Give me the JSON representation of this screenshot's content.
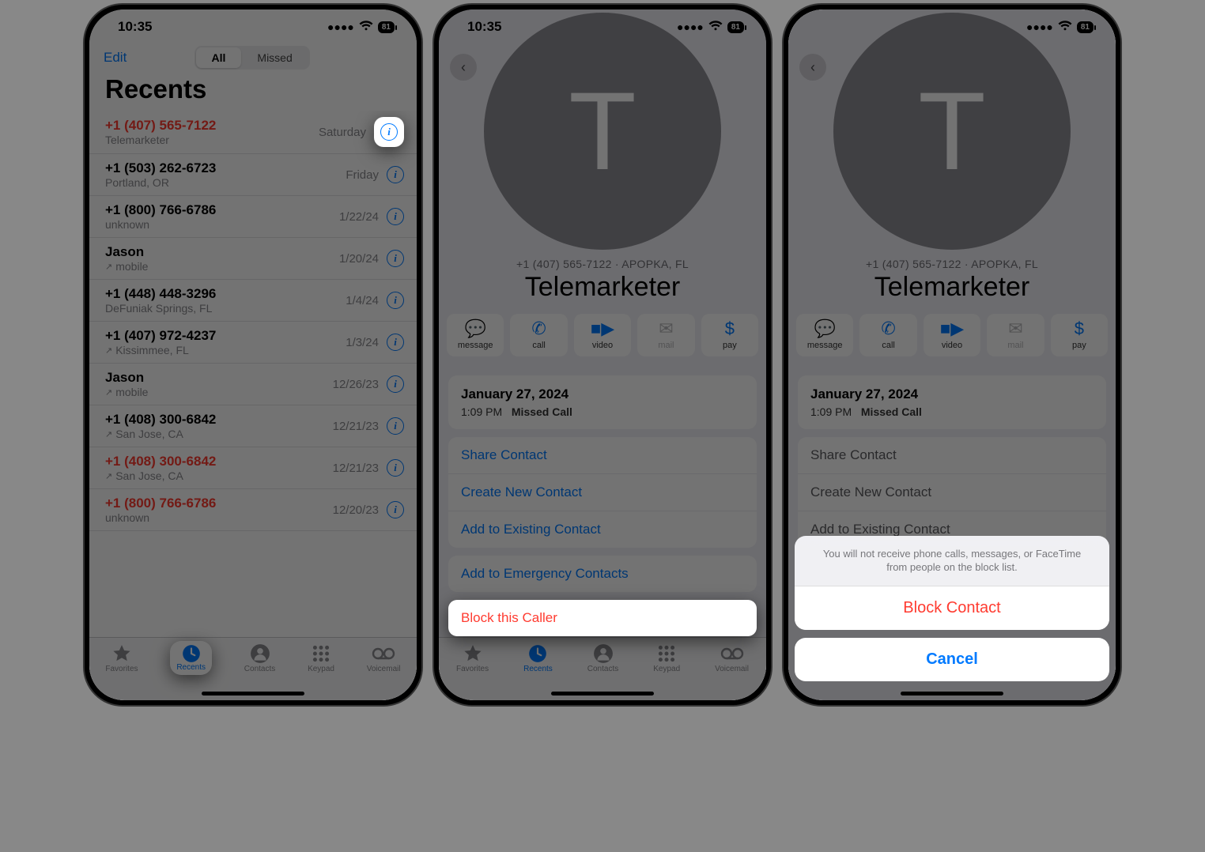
{
  "status": {
    "time": "10:35",
    "battery": "81"
  },
  "screen1": {
    "edit": "Edit",
    "segments": {
      "all": "All",
      "missed": "Missed"
    },
    "title": "Recents",
    "calls": [
      {
        "num": "+1 (407) 565-7122",
        "sub": "Telemarketer",
        "when": "Saturday",
        "missed": true,
        "outgoing": false,
        "highlight": true
      },
      {
        "num": "+1 (503) 262-6723",
        "sub": "Portland, OR",
        "when": "Friday",
        "missed": false,
        "outgoing": false
      },
      {
        "num": "+1 (800) 766-6786",
        "sub": "unknown",
        "when": "1/22/24",
        "missed": false,
        "outgoing": false
      },
      {
        "num": "Jason",
        "sub": "mobile",
        "when": "1/20/24",
        "missed": false,
        "outgoing": true
      },
      {
        "num": "+1 (448) 448-3296",
        "sub": "DeFuniak Springs, FL",
        "when": "1/4/24",
        "missed": false,
        "outgoing": false
      },
      {
        "num": "+1 (407) 972-4237",
        "sub": "Kissimmee, FL",
        "when": "1/3/24",
        "missed": false,
        "outgoing": true
      },
      {
        "num": "Jason",
        "sub": "mobile",
        "when": "12/26/23",
        "missed": false,
        "outgoing": true
      },
      {
        "num": "+1 (408) 300-6842",
        "sub": "San Jose, CA",
        "when": "12/21/23",
        "missed": false,
        "outgoing": true
      },
      {
        "num": "+1 (408) 300-6842",
        "sub": "San Jose, CA",
        "when": "12/21/23",
        "missed": true,
        "outgoing": true
      },
      {
        "num": "+1 (800) 766-6786",
        "sub": "unknown",
        "when": "12/20/23",
        "missed": true,
        "outgoing": false
      }
    ],
    "tabs": {
      "favorites": "Favorites",
      "recents": "Recents",
      "contacts": "Contacts",
      "keypad": "Keypad",
      "voicemail": "Voicemail"
    }
  },
  "contact": {
    "initial": "T",
    "meta": "+1 (407) 565-7122 · APOPKA, FL",
    "name": "Telemarketer",
    "actions": {
      "message": "message",
      "call": "call",
      "video": "video",
      "mail": "mail",
      "pay": "pay"
    },
    "log": {
      "date": "January 27, 2024",
      "time": "1:09 PM",
      "desc": "Missed Call"
    },
    "links": {
      "share": "Share Contact",
      "create": "Create New Contact",
      "add_existing": "Add to Existing Contact",
      "add_emergency": "Add to Emergency Contacts",
      "block": "Block this Caller"
    }
  },
  "sheet": {
    "info": "You will not receive phone calls, messages, or FaceTime from people on the block list.",
    "block": "Block Contact",
    "cancel": "Cancel"
  }
}
